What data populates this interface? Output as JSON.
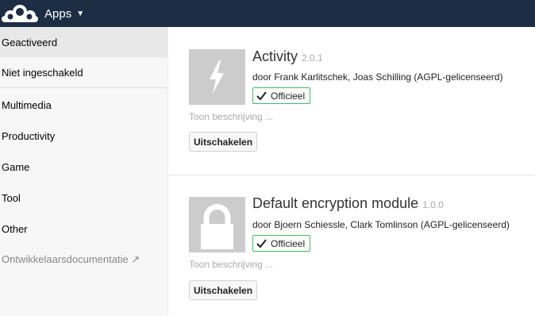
{
  "header": {
    "logo_icon": "owncloud-cloud-logo",
    "app_menu_label": "Apps",
    "caret_icon": "caret-down-icon",
    "background": "#1d2d44"
  },
  "sidebar": {
    "items": [
      {
        "label": "Geactiveerd",
        "active": true
      },
      {
        "label": "Niet ingeschakeld"
      },
      {
        "label": "Multimedia"
      },
      {
        "label": "Productivity"
      },
      {
        "label": "Game"
      },
      {
        "label": "Tool"
      },
      {
        "label": "Other"
      },
      {
        "label": "Ontwikkelaarsdocumentatie ↗",
        "external": true
      }
    ]
  },
  "apps": [
    {
      "name": "Activity",
      "version": "2.0.1",
      "author": "door Frank Karlitschek, Joas Schilling (AGPL-gelicenseerd)",
      "badge": "Officieel",
      "show_description": "Toon beschrijving ...",
      "button": "Uitschakelen",
      "icon": "lightning-icon"
    },
    {
      "name": "Default encryption module",
      "version": "1.0.0",
      "author": "door Bjoern Schiessle, Clark Tomlinson (AGPL-gelicenseerd)",
      "badge": "Officieel",
      "show_description": "Toon beschrijving ...",
      "button": "Uitschakelen",
      "icon": "lock-icon"
    }
  ],
  "colors": {
    "accent_badge": "#46ba61",
    "app_icon_bg": "#cccccc"
  }
}
